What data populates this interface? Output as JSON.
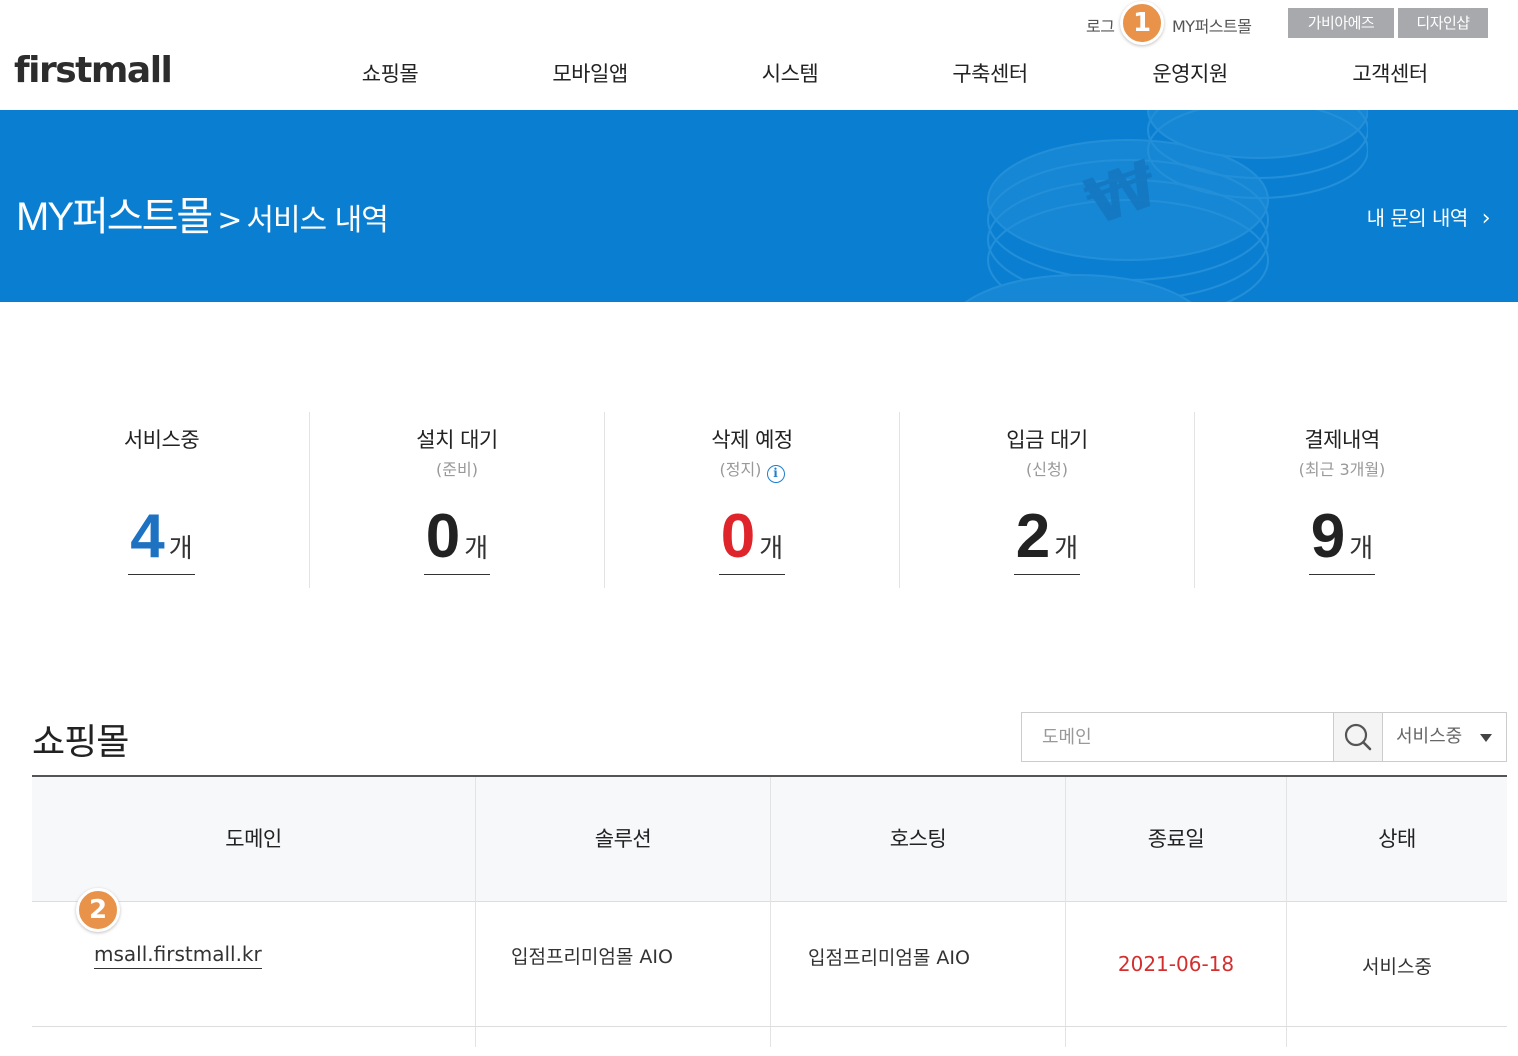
{
  "util": {
    "login": "로그",
    "my": "MY퍼스트몰",
    "btn1": "가비아에즈",
    "btn2": "디자인샵"
  },
  "markers": {
    "m1": "1",
    "m2": "2"
  },
  "logo": "firstmall",
  "gnb": [
    "쇼핑몰",
    "모바일앱",
    "시스템",
    "구축센터",
    "운영지원",
    "고객센터"
  ],
  "banner": {
    "title_big": "MY퍼스트몰",
    "title_sep": ">",
    "title_sub": "서비스 내역",
    "link": "내 문의 내역",
    "link_arrow": "›"
  },
  "stats": [
    {
      "label": "서비스중",
      "sub": "",
      "value": "4",
      "unit": "개",
      "color": "#1d72c2"
    },
    {
      "label": "설치 대기",
      "sub": "(준비)",
      "value": "0",
      "unit": "개",
      "color": "#222222"
    },
    {
      "label": "삭제 예정",
      "sub": "(정지)",
      "value": "0",
      "unit": "개",
      "color": "#e0242b",
      "info_icon": "info-icon"
    },
    {
      "label": "입금 대기",
      "sub": "(신청)",
      "value": "2",
      "unit": "개",
      "color": "#222222"
    },
    {
      "label": "결제내역",
      "sub": "(최근 3개월)",
      "value": "9",
      "unit": "개",
      "color": "#222222"
    }
  ],
  "section": {
    "title": "쇼핑몰",
    "search_placeholder": "도메인",
    "search_icon": "search-icon",
    "filter_value": "서비스중"
  },
  "table": {
    "headers": [
      "도메인",
      "솔루션",
      "호스팅",
      "종료일",
      "상태"
    ],
    "rows": [
      {
        "domain": "msall.firstmall.kr",
        "solution": "입점프리미엄몰 AIO",
        "hosting": "입점프리미엄몰 AIO",
        "end_date": "2021-06-18",
        "status": "서비스중"
      }
    ],
    "end_date_color": "#d32f2f"
  },
  "colors": {
    "accent": "#0a7fd1",
    "marker": "#e8924a",
    "util_btn": "#a7a9ac"
  }
}
